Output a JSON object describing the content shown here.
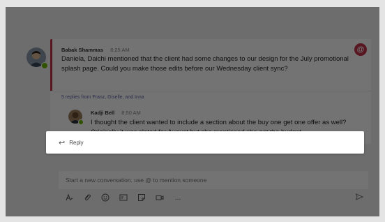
{
  "thread": {
    "author": "Babak Shammas",
    "time": "8:25 AM",
    "message": "Daniela, Daichi mentioned that the client had some changes to our design for the July promotional splash page. Could you make those edits before our Wednesday client sync?",
    "replies_summary": "5 replies from Franz, Giselle, and Inna",
    "mention_icon": "@"
  },
  "reply": {
    "author": "Kadji Bell",
    "time": "8:50 AM",
    "message": "I thought the client wanted to include a section about the buy one get one offer as well? Originally it was slated for August but she mentioned she got the budget"
  },
  "reply_bar": {
    "icon": "↩",
    "label": "Reply"
  },
  "compose": {
    "placeholder": "Start a new conversation. use @ to mention someone"
  },
  "toolbar": {
    "icons": [
      "format-icon",
      "attach-icon",
      "emoji-icon",
      "gif-icon",
      "sticker-icon",
      "meet-icon",
      "more-icon"
    ],
    "more_label": "..."
  },
  "colors": {
    "accent": "#c4314b",
    "presence": "#6bb700",
    "link": "#6264a7"
  }
}
